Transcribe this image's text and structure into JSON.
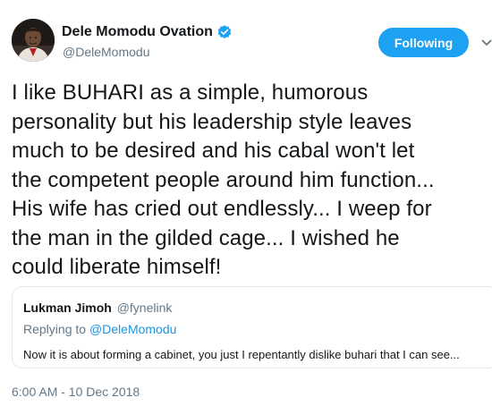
{
  "author": {
    "display_name": "Dele Momodu Ovation",
    "handle": "@DeleMomodu",
    "verified": true
  },
  "follow_button": {
    "label": "Following"
  },
  "icons": {
    "avatar": "profile-photo",
    "verified": "verified-badge-icon",
    "menu": "chevron-down-icon"
  },
  "tweet": {
    "lines": [
      "I like BUHARI as a simple, humorous",
      "personality but his leadership style leaves",
      "much to be desired and his cabal won't let",
      "the competent people around him function...",
      "His wife has cried out endlessly... I weep for",
      "the man in the gilded cage... I wished he",
      "could liberate himself!"
    ]
  },
  "quoted_tweet": {
    "author_name": "Lukman Jimoh",
    "author_handle": "@fynelink",
    "replying_prefix": "Replying to",
    "replying_to": "@DeleMomodu",
    "text": "Now it is about forming a cabinet, you just I repentantly dislike buhari that I can see..."
  },
  "timestamp": "6:00 AM - 10 Dec 2018",
  "colors": {
    "accent": "#1da1f2",
    "link": "#1b95e0",
    "secondary_text": "#657786",
    "border": "#e1e8ed"
  }
}
